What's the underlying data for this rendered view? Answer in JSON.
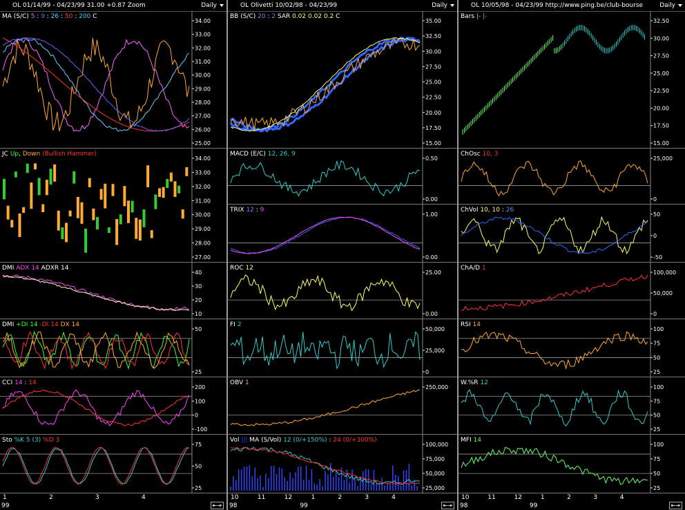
{
  "left": {
    "header": "OL   01/14/99 - 04/23/99   31.00   +0.87   Zoom",
    "period": "Daily",
    "panes": [
      {
        "id": "ma",
        "label": [
          [
            "MA (S/C) ",
            "#ffffff"
          ],
          [
            "5",
            "#ff66ff"
          ],
          [
            " : ",
            "#ffffff"
          ],
          [
            "9",
            "#6666ff"
          ],
          [
            " : ",
            "#ffffff"
          ],
          [
            "26",
            "#66ccff"
          ],
          [
            " : ",
            "#ffffff"
          ],
          [
            "50",
            "#ff4444"
          ],
          [
            " : ",
            "#ffffff"
          ],
          [
            "200",
            "#33ccff"
          ],
          [
            "   C ",
            "#ffffff"
          ]
        ],
        "ticks": [
          "34.00",
          "33.00",
          "32.00",
          "31.00",
          "30.00",
          "29.00",
          "28.00",
          "27.00",
          "26.00",
          "25.00"
        ]
      },
      {
        "id": "jc",
        "label": [
          [
            "JC ",
            "#ffffff"
          ],
          [
            "Up",
            "#33ff33"
          ],
          [
            ", ",
            "#ffffff"
          ],
          [
            "Down",
            "#ffaa33"
          ],
          [
            "  (Bullish Hammer)",
            "#ff3333"
          ]
        ],
        "ticks": [
          "34.00",
          "33.00",
          "32.00",
          "31.00",
          "30.00",
          "29.00",
          "28.00",
          "27.00"
        ]
      },
      {
        "id": "dmi1",
        "label": [
          [
            "DMI  ",
            "#ffffff"
          ],
          [
            "ADX 14",
            "#ff44ff"
          ],
          [
            "  ADXR 14",
            "#ffffff"
          ]
        ],
        "ticks": [
          "40",
          "30",
          "20",
          "10"
        ]
      },
      {
        "id": "dmi2",
        "label": [
          [
            "DMI  ",
            "#ffffff"
          ],
          [
            "+DI 14",
            "#33ff33"
          ],
          [
            "  ",
            "#ffffff"
          ],
          [
            "-DI 14",
            "#ff3333"
          ],
          [
            "  DX 14",
            "#ffaa33"
          ]
        ],
        "ticks": [
          "50",
          "25"
        ]
      },
      {
        "id": "cci",
        "label": [
          [
            "CCI  ",
            "#ffffff"
          ],
          [
            "14",
            "#ff44ff"
          ],
          [
            " : ",
            "#ffffff"
          ],
          [
            "14",
            "#ff3333"
          ]
        ],
        "ticks": [
          "200",
          "100",
          "0",
          "-100"
        ]
      },
      {
        "id": "sto",
        "label": [
          [
            "Sto  ",
            "#ffffff"
          ],
          [
            "%K 5 (3)",
            "#33cccc"
          ],
          [
            "  ",
            "#ffffff"
          ],
          [
            "%D 3",
            "#ff3333"
          ]
        ],
        "ticks": [
          "75",
          "50",
          "25"
        ]
      }
    ],
    "x_labels": [
      "1",
      "2",
      "3",
      "4"
    ],
    "year_label": "99"
  },
  "middle": {
    "header": "OL   Olivetti   10/02/98 - 04/23/99",
    "period": "Daily",
    "panes": [
      {
        "id": "bb",
        "label": [
          [
            "BB (S/C)  ",
            "#ffffff"
          ],
          [
            "20",
            "#6688ff"
          ],
          [
            " : ",
            "#ffffff"
          ],
          [
            "2",
            "#6688ff"
          ],
          [
            "   SAR  ",
            "#ffffff"
          ],
          [
            "0.02",
            "#ffff66"
          ],
          [
            "  ",
            "#ffffff"
          ],
          [
            "0.02",
            "#ffff66"
          ],
          [
            "  ",
            "#ffffff"
          ],
          [
            "0.2",
            "#ffff66"
          ],
          [
            "    C ",
            "#ffffff"
          ]
        ],
        "ticks": [
          "35.00",
          "32.50",
          "30.00",
          "27.50",
          "25.00",
          "22.50",
          "20.00",
          "17.50",
          "15.00"
        ]
      },
      {
        "id": "macd",
        "label": [
          [
            "MACD (E/C)  ",
            "#ffffff"
          ],
          [
            "12, 26, 9",
            "#33cccc"
          ]
        ],
        "ticks": [
          "0.50",
          "0.00"
        ]
      },
      {
        "id": "trix",
        "label": [
          [
            "TRIX  ",
            "#ffffff"
          ],
          [
            "12",
            "#6688ff"
          ],
          [
            " : ",
            "#ffffff"
          ],
          [
            "9",
            "#ff44ff"
          ]
        ],
        "ticks": [
          "1.00",
          "0.00"
        ]
      },
      {
        "id": "roc",
        "label": [
          [
            "ROC  ",
            "#ffffff"
          ],
          [
            "12",
            "#ffff66"
          ]
        ],
        "ticks": [
          "25.00",
          "0.00"
        ]
      },
      {
        "id": "fi",
        "label": [
          [
            "FI  ",
            "#ffffff"
          ],
          [
            "2",
            "#33cccc"
          ]
        ],
        "ticks": [
          "50,000",
          "25,000",
          "0"
        ]
      },
      {
        "id": "obv",
        "label": [
          [
            "OBV  ",
            "#ffffff"
          ],
          [
            "1",
            "#ffaa33"
          ]
        ],
        "ticks": [
          "250,000"
        ]
      },
      {
        "id": "vol",
        "label": [
          [
            "Vol  ",
            "#ffffff"
          ],
          [
            "|||",
            "#3344ff"
          ],
          [
            "   MA (S/Vol)  ",
            "#ffffff"
          ],
          [
            "12 (0/+150%)",
            "#33cccc"
          ],
          [
            " : ",
            "#ffffff"
          ],
          [
            "24 (0/+300%)",
            "#ff3333"
          ]
        ],
        "ticks": [
          "100,000",
          "75,000",
          "50,000",
          "25,000"
        ]
      }
    ],
    "x_labels": [
      "10",
      "11",
      "12",
      "1",
      "2",
      "3",
      "4"
    ],
    "year_labels": [
      "98",
      "99"
    ]
  },
  "right": {
    "header": "OL   10/05/98 - 04/23/99     http://www.ping.be/club-bourse",
    "period": "Daily",
    "panes": [
      {
        "id": "bars",
        "label": [
          [
            "Bars  ",
            "#ffffff"
          ],
          [
            "|- ",
            "#66ff66"
          ],
          [
            "|-",
            "#33cccc"
          ]
        ],
        "ticks": [
          "32.50",
          "30.00",
          "27.50",
          "25.00",
          "22.50",
          "20.00",
          "17.50",
          "15.00"
        ]
      },
      {
        "id": "chosc",
        "label": [
          [
            "ChOsc  ",
            "#ffffff"
          ],
          [
            "10, 3",
            "#ff3333"
          ]
        ],
        "ticks": [
          "25,000",
          "0"
        ]
      },
      {
        "id": "chvol",
        "label": [
          [
            "ChVol  ",
            "#ffffff"
          ],
          [
            "10, 10",
            "#ffff66"
          ],
          [
            "  :  ",
            "#ffffff"
          ],
          [
            "26",
            "#6688ff"
          ]
        ],
        "ticks": [
          "50",
          "0",
          "-50"
        ]
      },
      {
        "id": "chad",
        "label": [
          [
            "ChA/D  ",
            "#ffffff"
          ],
          [
            "1",
            "#ff3333"
          ]
        ],
        "ticks": [
          "100,000",
          "50,000",
          "0"
        ]
      },
      {
        "id": "rsi",
        "label": [
          [
            "RSI  ",
            "#ffffff"
          ],
          [
            "14",
            "#ffaa33"
          ]
        ],
        "ticks": [
          "100",
          "75",
          "50",
          "25"
        ]
      },
      {
        "id": "wr",
        "label": [
          [
            "W.%R  ",
            "#ffffff"
          ],
          [
            "12",
            "#33cccc"
          ]
        ],
        "ticks": [
          "100",
          "75",
          "50",
          "25"
        ]
      },
      {
        "id": "mfi",
        "label": [
          [
            "MFI  ",
            "#ffffff"
          ],
          [
            "14",
            "#66ff66"
          ]
        ],
        "ticks": [
          "100",
          "75",
          "50",
          "25"
        ]
      }
    ],
    "x_labels": [
      "10",
      "11",
      "12",
      "1",
      "2",
      "3",
      "4"
    ],
    "year_labels": [
      "98",
      "99"
    ]
  },
  "colors": {
    "bg": "#000000",
    "grid": "#aaaaaa",
    "axis_text": "#ffffff"
  }
}
